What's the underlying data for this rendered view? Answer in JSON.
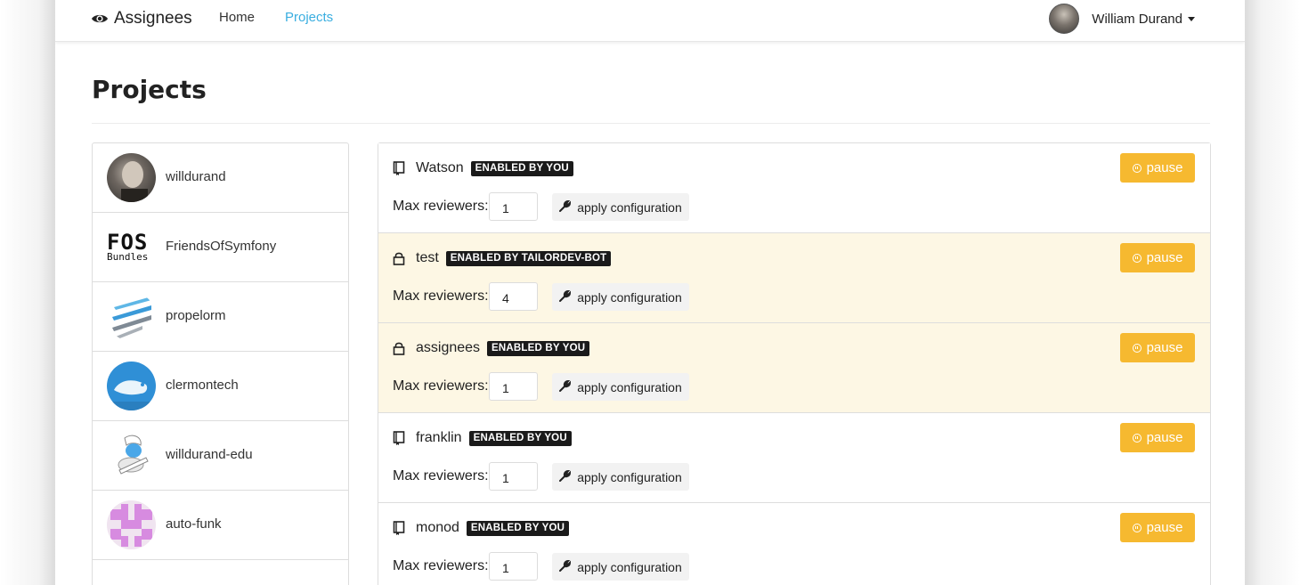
{
  "navbar": {
    "brand": "Assignees",
    "links": [
      {
        "label": "Home",
        "active": false
      },
      {
        "label": "Projects",
        "active": true
      }
    ],
    "user": "William Durand"
  },
  "page": {
    "title": "Projects"
  },
  "colors": {
    "accent": "#3aaee0",
    "pause": "#f6b930",
    "private_bg": "#fdf7e4",
    "badge_bg": "#1a1a1a"
  },
  "sidebar": {
    "orgs": [
      {
        "name": "willdurand",
        "avatar": "avatar-photo"
      },
      {
        "name": "FriendsOfSymfony",
        "avatar": "fos-logo",
        "logo_text": "FOS",
        "logo_sub": "Bundles"
      },
      {
        "name": "propelorm",
        "avatar": "propel-logo"
      },
      {
        "name": "clermontech",
        "avatar": "clermontech-logo"
      },
      {
        "name": "willdurand-edu",
        "avatar": "smurf-logo"
      },
      {
        "name": "auto-funk",
        "avatar": "identicon"
      }
    ]
  },
  "repos": [
    {
      "name": "Watson",
      "icon": "repo-icon",
      "badge": "ENABLED BY YOU",
      "private": false,
      "max_label": "Max reviewers:",
      "max_reviewers": "1",
      "pause_label": "pause",
      "apply_label": "apply configuration"
    },
    {
      "name": "test",
      "icon": "lock-icon",
      "badge": "ENABLED BY TAILORDEV-BOT",
      "private": true,
      "max_label": "Max reviewers:",
      "max_reviewers": "4",
      "pause_label": "pause",
      "apply_label": "apply configuration"
    },
    {
      "name": "assignees",
      "icon": "lock-icon",
      "badge": "ENABLED BY YOU",
      "private": true,
      "max_label": "Max reviewers:",
      "max_reviewers": "1",
      "pause_label": "pause",
      "apply_label": "apply configuration"
    },
    {
      "name": "franklin",
      "icon": "repo-icon",
      "badge": "ENABLED BY YOU",
      "private": false,
      "max_label": "Max reviewers:",
      "max_reviewers": "1",
      "pause_label": "pause",
      "apply_label": "apply configuration"
    },
    {
      "name": "monod",
      "icon": "repo-icon",
      "badge": "ENABLED BY YOU",
      "private": false,
      "max_label": "Max reviewers:",
      "max_reviewers": "1",
      "pause_label": "pause",
      "apply_label": "apply configuration"
    }
  ]
}
